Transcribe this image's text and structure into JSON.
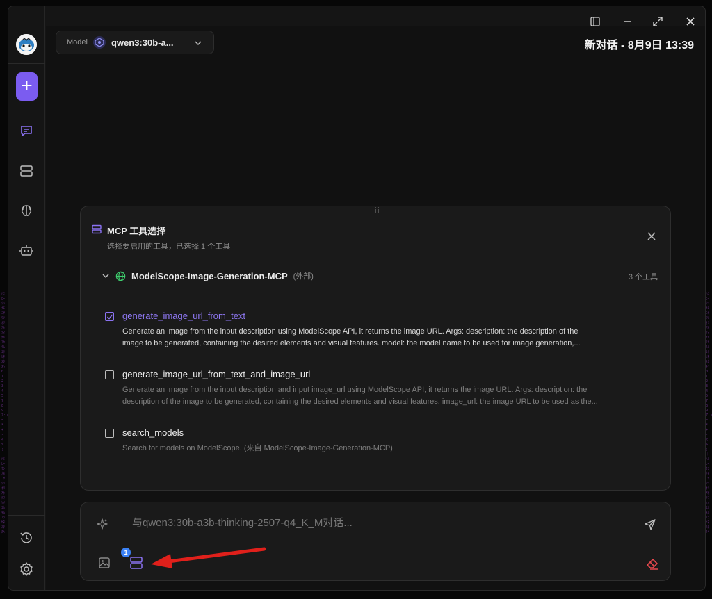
{
  "header": {
    "model_label": "Model",
    "model_name": "qwen3:30b-a...",
    "conversation_title": "新对话 - 8月9日 13:39"
  },
  "mcp_panel": {
    "title": "MCP 工具选择",
    "subtitle": "选择要启用的工具，已选择 1 个工具",
    "server": {
      "name": "ModelScope-Image-Generation-MCP",
      "tag": "(外部)",
      "count": "3 个工具"
    },
    "tools": [
      {
        "name": "generate_image_url_from_text",
        "checked": true,
        "desc_line1": "Generate an image from the input description using ModelScope API, it returns the image URL. Args: description: the description of the",
        "desc_line2": "image to be generated, containing the desired elements and visual features. model: the model name to be used for image generation,..."
      },
      {
        "name": "generate_image_url_from_text_and_image_url",
        "checked": false,
        "desc_line1": "Generate an image from the input description and input image_url using ModelScope API, it returns the image URL. Args: description: the",
        "desc_line2": "description of the image to be generated, containing the desired elements and visual features. image_url: the image URL to be used as the..."
      },
      {
        "name": "search_models",
        "checked": false,
        "desc_line1": "Search for models on ModelScope. (来自 ModelScope-Image-Generation-MCP)",
        "desc_line2": ""
      }
    ]
  },
  "composer": {
    "placeholder": "与qwen3:30b-a3b-thinking-2507-q4_K_M对话...",
    "mcp_badge": "1"
  },
  "colors": {
    "accent": "#7b5cf0",
    "badge": "#3b82f6",
    "danger": "#e5484d",
    "annotation_arrow": "#e0201b"
  }
}
